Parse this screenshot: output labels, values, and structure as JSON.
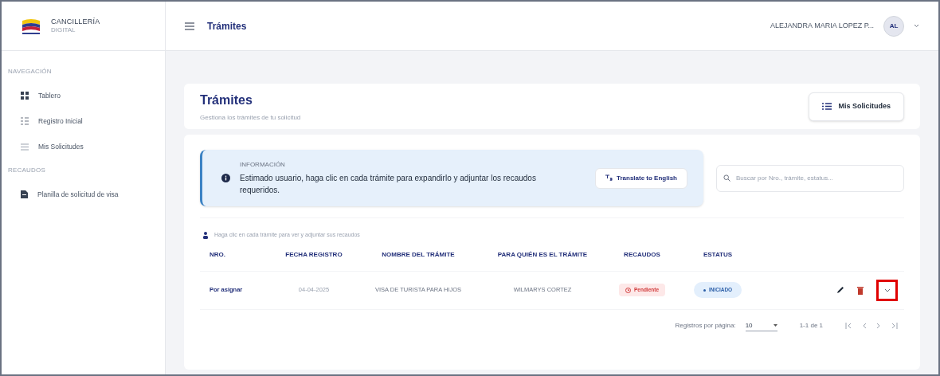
{
  "brand": {
    "name": "CANCILLERÍA",
    "subtitle": "DIGITAL"
  },
  "sidebar": {
    "sections": [
      {
        "title": "NAVEGACIÓN",
        "items": [
          {
            "label": "Tablero",
            "selected": false
          },
          {
            "label": "Registro Inicial",
            "selected": false
          },
          {
            "label": "Mis Solicitudes",
            "selected": false
          }
        ]
      },
      {
        "title": "RECAUDOS",
        "items": [
          {
            "label": "Planilla de solicitud de visa",
            "selected": false
          }
        ]
      }
    ]
  },
  "header": {
    "title": "Trámites",
    "user": "ALEJANDRA MARIA LOPEZ P...",
    "avatar": "AL"
  },
  "page": {
    "title": "Trámites",
    "subtitle": "Gestiona los trámites de tu solicitud",
    "button": "Mis Solicitudes"
  },
  "info": {
    "label": "INFORMACIÓN",
    "message": "Estimado usuario, haga clic en cada trámite para expandirlo y adjuntar los recaudos requeridos.",
    "button": "Translate to English"
  },
  "search": {
    "placeholder": "Buscar por Nro., trámite, estatus..."
  },
  "hint": "Haga clic en cada trámite para ver y adjuntar sus recaudos",
  "table": {
    "columns": [
      "NRO.",
      "FECHA REGISTRO",
      "NOMBRE DEL TRÁMITE",
      "PARA QUIÉN ES EL TRÁMITE",
      "RECAUDOS",
      "ESTATUS"
    ],
    "rows": [
      {
        "number": "Por asignar",
        "date": "04-04-2025",
        "name": "VISA DE TURISTA PARA HIJOS",
        "for": "WILMARYS CORTEZ",
        "recaudos": "Pendiente",
        "status": "INICIADO",
        "expand_highlighted": true
      }
    ]
  },
  "pagination": {
    "label": "Registros por página:",
    "per_page": "10",
    "range": "1-1 de 1"
  }
}
